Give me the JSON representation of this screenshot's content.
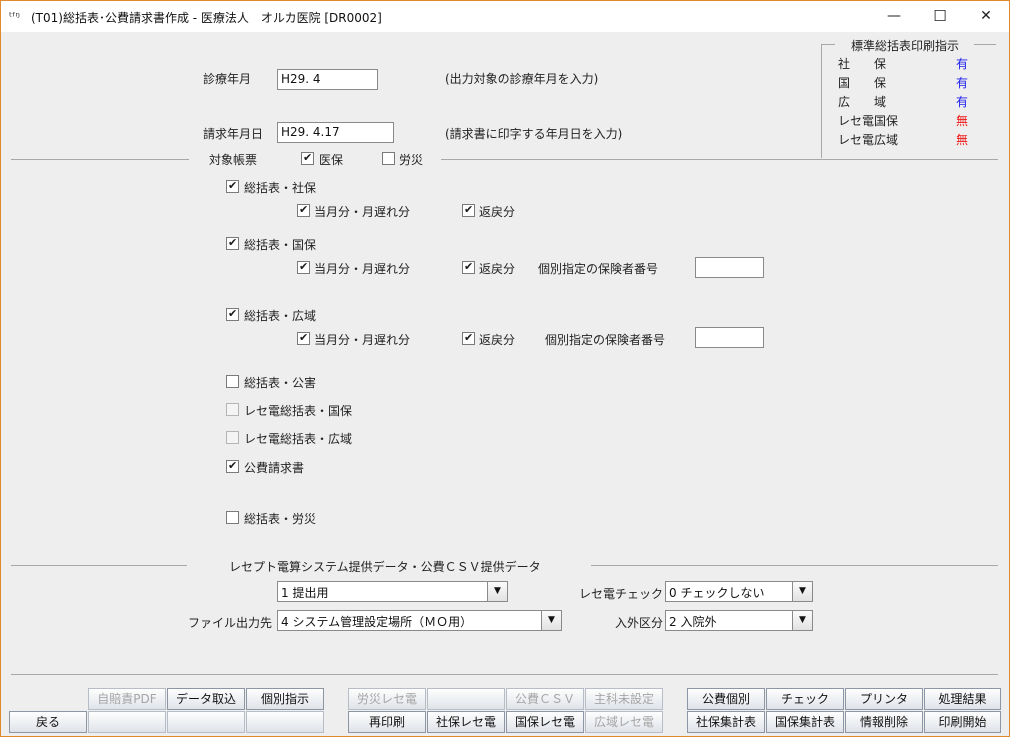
{
  "window": {
    "app_icon": "ᵗᶠᵑ",
    "title": "(T01)総括表･公費請求書作成 - 医療法人　オルカ医院 [DR0002]",
    "minimize_icon": "—",
    "maximize_icon": "☐",
    "close_icon": "✕"
  },
  "form": {
    "shinryo_label": "診療年月",
    "shinryo_value": "H29. 4",
    "shinryo_hint": "(出力対象の診療年月を入力)",
    "seikyu_label": "請求年月日",
    "seikyu_value": "H29. 4.17",
    "seikyu_hint": "(請求書に印字する年月日を入力)"
  },
  "indicator": {
    "title": "標準総括表印刷指示",
    "rows": [
      {
        "label": "社　　保",
        "value": "有",
        "color": "#1a1aee"
      },
      {
        "label": "国　　保",
        "value": "有",
        "color": "#1a1aee"
      },
      {
        "label": "広　　域",
        "value": "有",
        "color": "#1a1aee"
      },
      {
        "label": "レセ電国保",
        "value": "無",
        "color": "#ee1a1a"
      },
      {
        "label": "レセ電広域",
        "value": "無",
        "color": "#ee1a1a"
      }
    ]
  },
  "target": {
    "label": "対象帳票",
    "iho": "医保",
    "rosai": "労災"
  },
  "reports": {
    "shaho": "総括表・社保",
    "shaho_tsuki": "当月分・月遅れ分",
    "shaho_henrei": "返戻分",
    "kokuho": "総括表・国保",
    "kokuho_tsuki": "当月分・月遅れ分",
    "kokuho_henrei": "返戻分",
    "kokuho_kobetsu": "個別指定の保険者番号",
    "koiki": "総括表・広域",
    "koiki_tsuki": "当月分・月遅れ分",
    "koiki_henrei": "返戻分",
    "koiki_kobetsu": "個別指定の保険者番号",
    "kogai": "総括表・公害",
    "rece_kokuho": "レセ電総括表・国保",
    "rece_koiki": "レセ電総括表・広域",
    "kohi": "公費請求書",
    "rosai": "総括表・労災"
  },
  "rece": {
    "section_title": "レセプト電算システム提供データ・公費ＣＳＶ提供データ",
    "teishutsu_value": "1 提出用",
    "check_label": "レセ電チェック",
    "check_value": "0 チェックしない",
    "file_label": "ファイル出力先",
    "file_value": "4 システム管理設定場所（ＭＯ用）",
    "nyugai_label": "入外区分",
    "nyugai_value": "2 入院外",
    "arrow_icon": "▼"
  },
  "buttons": {
    "back": "戻る",
    "jibaiseki": "自賠責PDF",
    "data_torikomi": "データ取込",
    "kobetsu_shiji": "個別指示",
    "rosai_rece": "労災レセ電",
    "kohi_csv": "公費ＣＳＶ",
    "shuka_misettei": "主科未設定",
    "kohi_kobetsu": "公費個別",
    "check": "チェック",
    "printer": "プリンタ",
    "shori_kekka": "処理結果",
    "reinsatsu": "再印刷",
    "shaho_rece": "社保レセ電",
    "kokuho_rece": "国保レセ電",
    "koiki_rece": "広域レセ電",
    "shaho_shukei": "社保集計表",
    "kokuho_shukei": "国保集計表",
    "joho_sakujo": "情報削除",
    "insatsu_kaishi": "印刷開始"
  }
}
